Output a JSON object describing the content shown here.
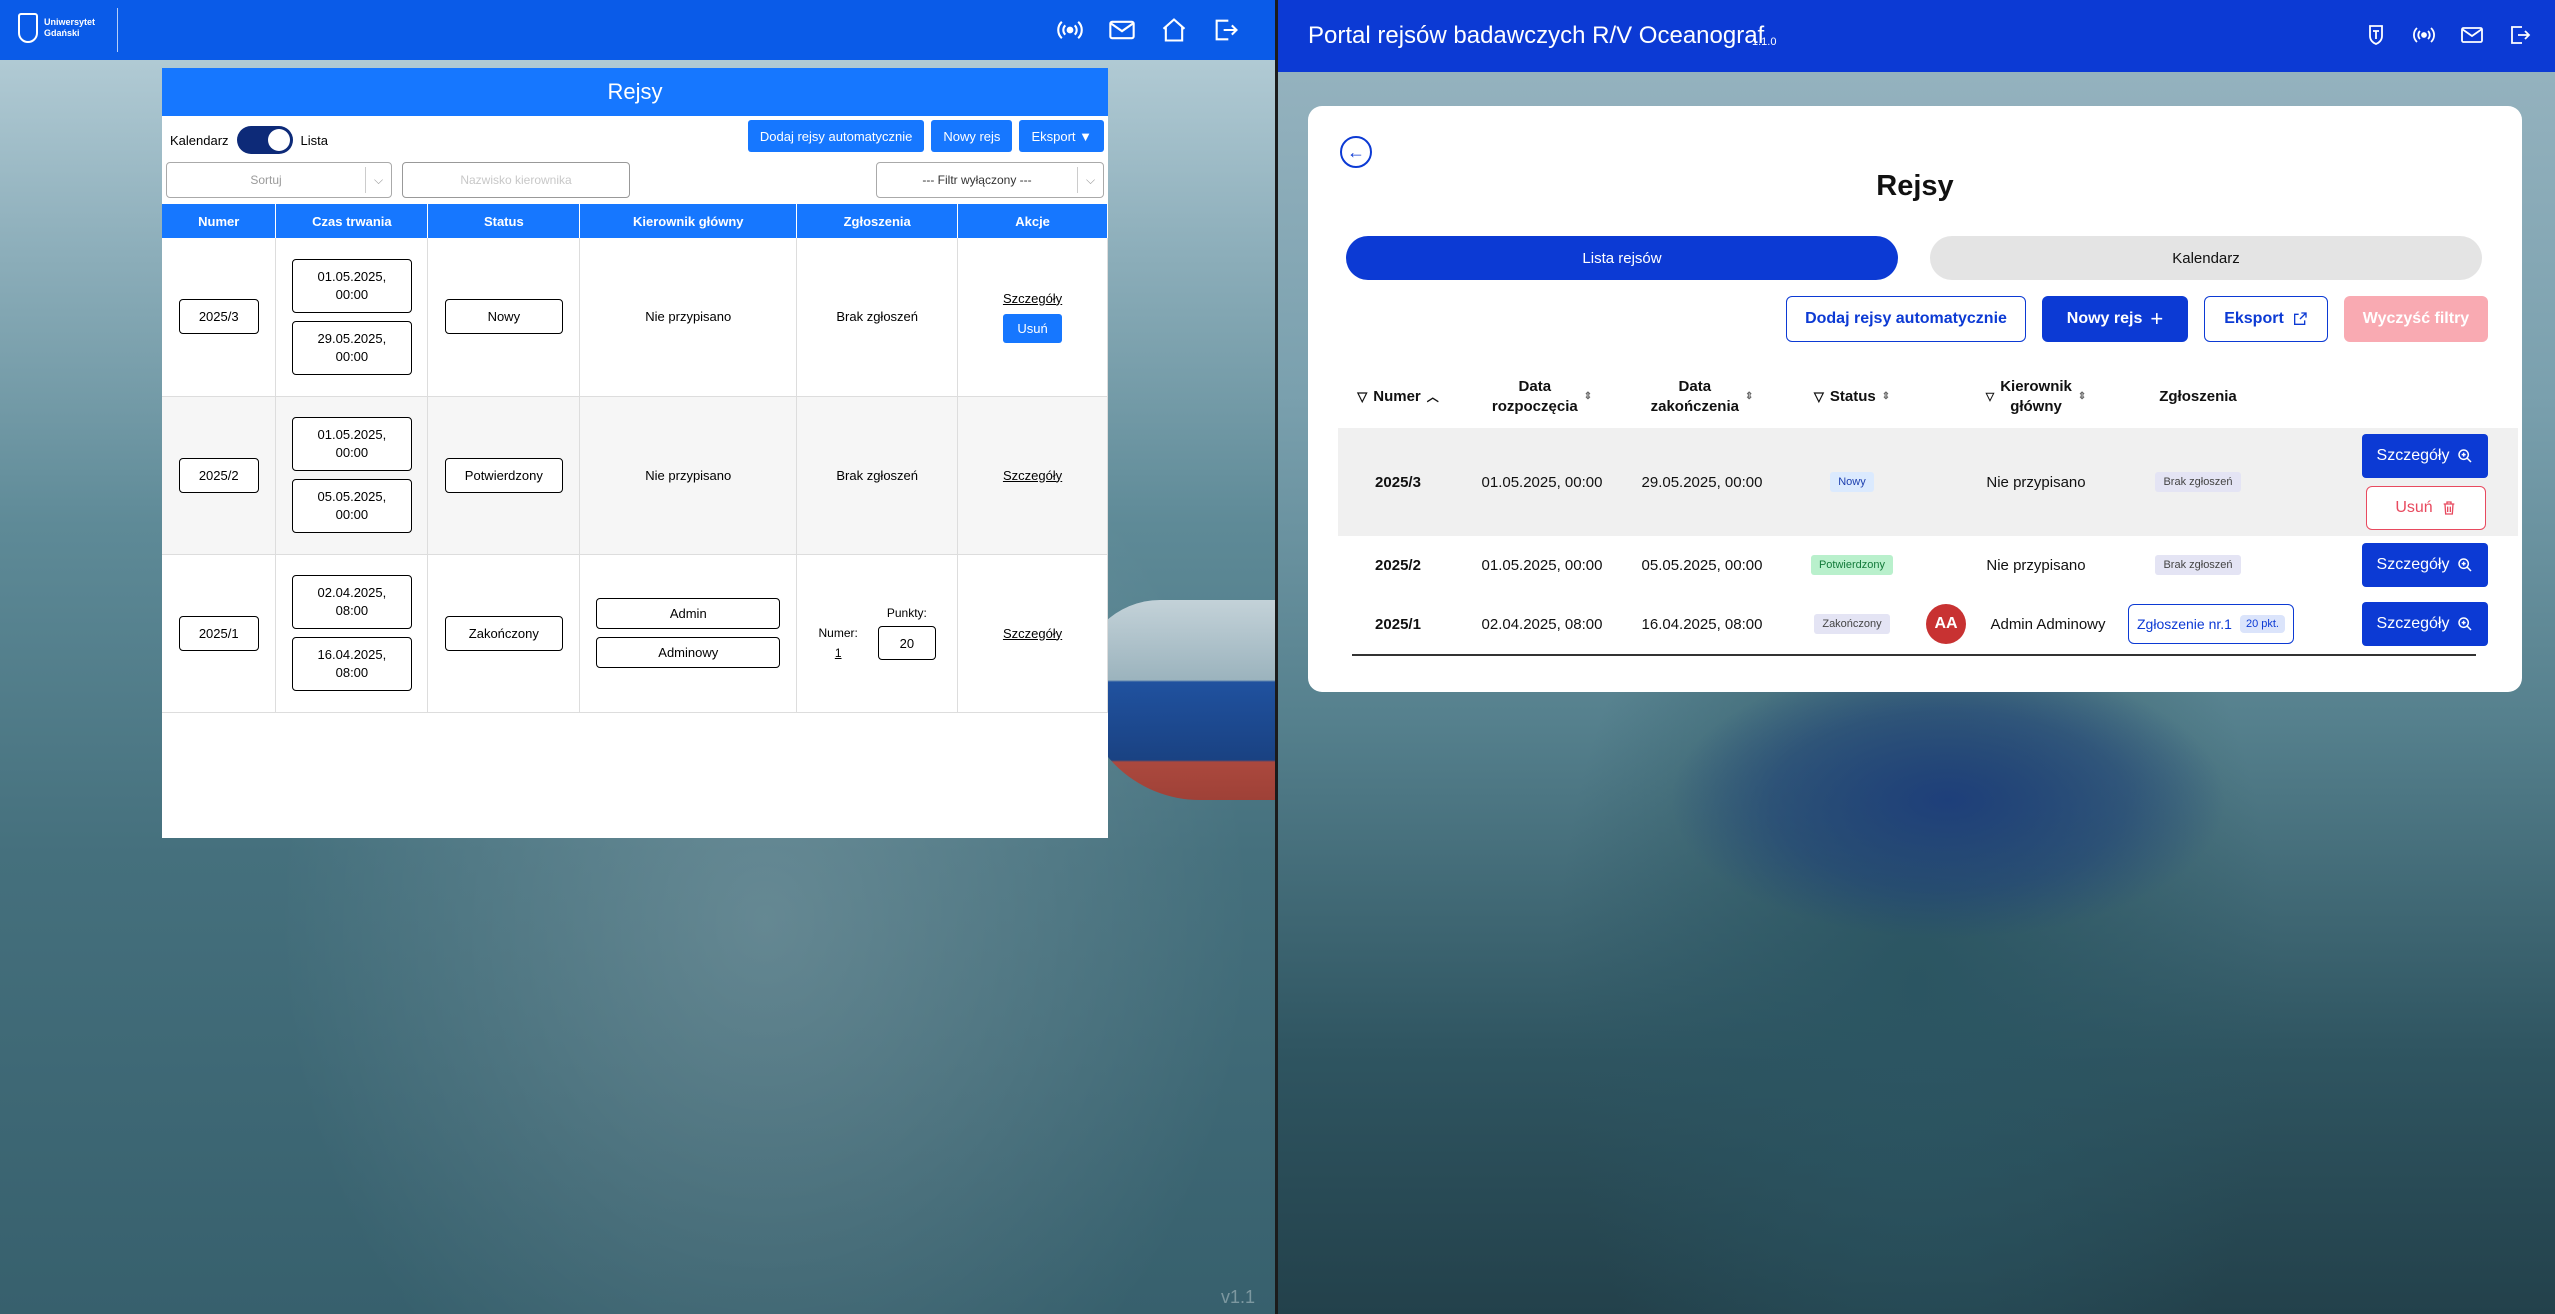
{
  "left": {
    "logo_text": [
      "Uniwersytet",
      "Gdański"
    ],
    "title": "Rejsy",
    "toggle": {
      "left_label": "Kalendarz",
      "right_label": "Lista"
    },
    "buttons": {
      "auto": "Dodaj rejsy automatycznie",
      "new": "Nowy rejs",
      "export": "Eksport ▼"
    },
    "sort_placeholder": "Sortuj",
    "search_placeholder": "Nazwisko kierownika",
    "filter_label": "--- Filtr wyłączony ---",
    "columns": [
      "Numer",
      "Czas trwania",
      "Status",
      "Kierownik główny",
      "Zgłoszenia",
      "Akcje"
    ],
    "rows": [
      {
        "numer": "2025/3",
        "start": "01.05.2025,",
        "start_time": "00:00",
        "end": "29.05.2025,",
        "end_time": "00:00",
        "status": "Nowy",
        "kierownik": "Nie przypisano",
        "zgloszenia": "Brak zgłoszeń",
        "details": "Szczegóły",
        "delete": "Usuń"
      },
      {
        "numer": "2025/2",
        "start": "01.05.2025,",
        "start_time": "00:00",
        "end": "05.05.2025,",
        "end_time": "00:00",
        "status": "Potwierdzony",
        "kierownik": "Nie przypisano",
        "zgloszenia": "Brak zgłoszeń",
        "details": "Szczegóły"
      },
      {
        "numer": "2025/1",
        "start": "02.04.2025,",
        "start_time": "08:00",
        "end": "16.04.2025,",
        "end_time": "08:00",
        "status": "Zakończony",
        "kierownik_first": "Admin",
        "kierownik_last": "Adminowy",
        "numer_label": "Numer:",
        "numer_value": "1",
        "punkty_label": "Punkty:",
        "punkty_value": "20",
        "details": "Szczegóły"
      }
    ],
    "version": "v1.1"
  },
  "right": {
    "portal_title": "Portal rejsów badawczych R/V Oceanograf",
    "version": "1.1.0",
    "title": "Rejsy",
    "tabs": {
      "list": "Lista rejsów",
      "calendar": "Kalendarz"
    },
    "buttons": {
      "auto": "Dodaj rejsy automatycznie",
      "new": "Nowy rejs",
      "export": "Eksport",
      "clear": "Wyczyść filtry"
    },
    "columns": {
      "numer": "Numer",
      "start1": "Data",
      "start2": "rozpoczęcia",
      "end1": "Data",
      "end2": "zakończenia",
      "status": "Status",
      "kier1": "Kierownik",
      "kier2": "główny",
      "zgl": "Zgłoszenia"
    },
    "rows": [
      {
        "numer": "2025/3",
        "start": "01.05.2025, 00:00",
        "end": "29.05.2025, 00:00",
        "status": "Nowy",
        "kierownik": "Nie przypisano",
        "zgl": "Brak zgłoszeń",
        "details": "Szczegóły",
        "delete": "Usuń"
      },
      {
        "numer": "2025/2",
        "start": "01.05.2025, 00:00",
        "end": "05.05.2025, 00:00",
        "status": "Potwierdzony",
        "kierownik": "Nie przypisano",
        "zgl": "Brak zgłoszeń",
        "details": "Szczegóły"
      },
      {
        "numer": "2025/1",
        "start": "02.04.2025, 08:00",
        "end": "16.04.2025, 08:00",
        "status": "Zakończony",
        "avatar": "AA",
        "kierownik": "Admin Adminowy",
        "zgl": "Zgłoszenie nr.1",
        "pkt": "20 pkt.",
        "details": "Szczegóły"
      }
    ]
  },
  "colors": {
    "left_blue": "#1677ff",
    "right_blue": "#0c3ad4",
    "danger": "#e84a5f"
  }
}
